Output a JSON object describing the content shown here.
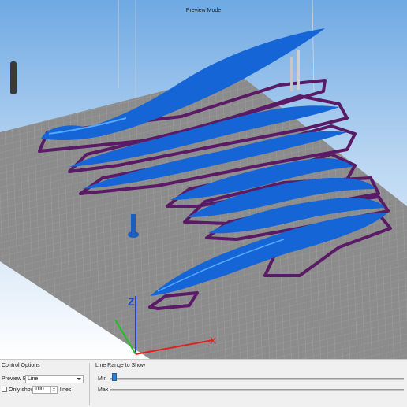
{
  "viewport": {
    "mode_title": "Preview Mode",
    "axis_labels": {
      "z": "Z",
      "x": "X"
    }
  },
  "control_options": {
    "title": "Control Options",
    "preview_by_label": "Preview By",
    "preview_by_value": "Line",
    "only_show_label": "Only show",
    "only_show_checked": false,
    "lines_value": "100",
    "lines_suffix": "lines"
  },
  "line_range": {
    "title": "Line Range to Show",
    "min_label": "Min",
    "max_label": "Max",
    "min_fraction": 0.0,
    "max_fraction": 1.0
  },
  "colors": {
    "sky_top": "#6fa9e3",
    "sky_bottom": "#ffffff",
    "bed": "#8a8a8a",
    "grid": "#b7b7b7",
    "model": "#1565d6",
    "model_highlight": "#55a8ff",
    "raft_outline": "#5a1a66",
    "axis_x": "#e02020",
    "axis_y": "#20c020",
    "axis_z": "#2040e0",
    "slider_handle": "#2a7fd4"
  }
}
